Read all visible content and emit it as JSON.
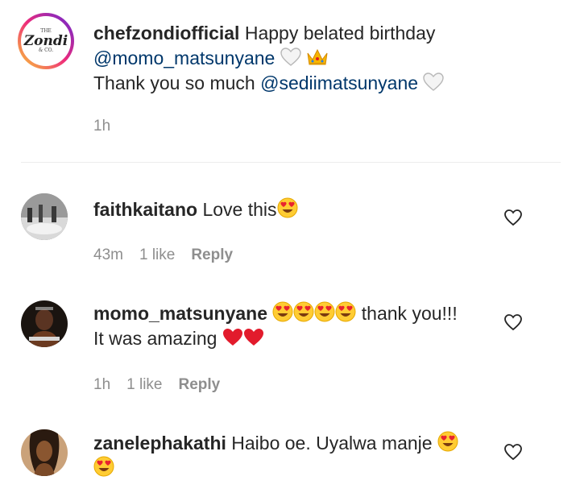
{
  "caption": {
    "username": "chefzondiofficial",
    "text_line1": "Happy belated birthday",
    "mention1": "@momo_matsunyane",
    "line2_emojis": [
      "white-heart-emoji",
      "crown-emoji"
    ],
    "text_line3": "Thank you so much",
    "mention2": "@sediimatsunyane",
    "line3_emoji": "white-heart-emoji",
    "time": "1h",
    "avatar_logo": {
      "brand": "Zondi",
      "small_top": "THE",
      "small_bottom": "& CO."
    }
  },
  "comments": [
    {
      "username": "faithkaitano",
      "text": "Love this",
      "emojis": [
        "heart-eyes-emoji"
      ],
      "time": "43m",
      "likes": "1 like",
      "reply": "Reply"
    },
    {
      "username": "momo_matsunyane",
      "text_after_emojis": "thank you!!!",
      "emojis_before": [
        "heart-eyes-emoji",
        "heart-eyes-emoji",
        "heart-eyes-emoji",
        "heart-eyes-emoji"
      ],
      "text_line2": "It was amazing",
      "emojis_after": [
        "red-heart-emoji",
        "red-heart-emoji"
      ],
      "time": "1h",
      "likes": "1 like",
      "reply": "Reply"
    },
    {
      "username": "zanelephakathi",
      "text": "Haibo oe. Uyalwa manje",
      "emojis": [
        "heart-eyes-emoji",
        "heart-eyes-emoji"
      ]
    }
  ],
  "colors": {
    "text": "#262626",
    "mention": "#00376b",
    "meta": "#8e8e8e",
    "divider": "#ececec"
  }
}
